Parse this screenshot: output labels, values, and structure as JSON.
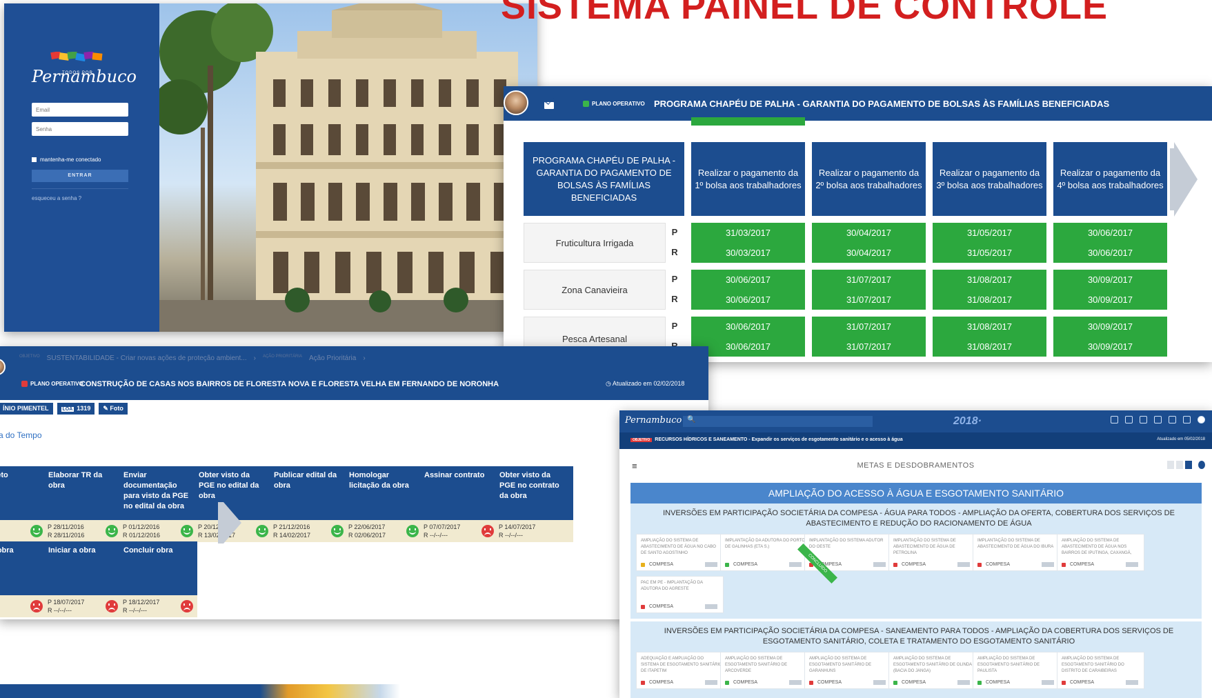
{
  "headline": "SISTEMA PAINEL DE CONTROLE",
  "login": {
    "logo_text": "Pernambuco",
    "logo_small": "TODOS POR",
    "email_placeholder": "Email",
    "password_placeholder": "Senha",
    "remember_label": "mantenha-me conectado",
    "submit_label": "ENTRAR",
    "forgot_label": "esqueceu a senha ?"
  },
  "chapeu": {
    "plano_label": "PLANO OPERATIVO",
    "title": "PROGRAMA CHAPÉU DE PALHA - GARANTIA DO PAGAMENTO DE BOLSAS ÀS FAMÍLIAS BENEFICIADAS",
    "head": "PROGRAMA CHAPÉU DE PALHA - GARANTIA DO PAGAMENTO DE BOLSAS ÀS FAMÍLIAS BENEFICIADAS",
    "columns": [
      "Realizar o pagamento da 1º bolsa aos trabalhadores",
      "Realizar o pagamento da 2º bolsa aos trabalhadores",
      "Realizar o pagamento da 3º bolsa aos trabalhadores",
      "Realizar o pagamento da 4º bolsa aos trabalhadores"
    ],
    "p_label": "P",
    "r_label": "R",
    "rows": [
      {
        "label": "Fruticultura Irrigada",
        "p": [
          "31/03/2017",
          "30/04/2017",
          "31/05/2017",
          "30/06/2017"
        ],
        "r": [
          "30/03/2017",
          "30/04/2017",
          "31/05/2017",
          "30/06/2017"
        ]
      },
      {
        "label": "Zona Canavieira",
        "p": [
          "30/06/2017",
          "31/07/2017",
          "31/08/2017",
          "30/09/2017"
        ],
        "r": [
          "30/06/2017",
          "31/07/2017",
          "31/08/2017",
          "30/09/2017"
        ]
      },
      {
        "label": "Pesca Artesanal",
        "p": [
          "30/06/2017",
          "31/07/2017",
          "31/08/2017",
          "30/09/2017"
        ],
        "r": [
          "30/06/2017",
          "31/07/2017",
          "31/08/2017",
          "30/09/2017"
        ]
      }
    ]
  },
  "construcao": {
    "crumb1": "SUSTENTABILIDADE - Criar novas ações de proteção ambient...",
    "crumb2": "Ação Prioritária",
    "plano_label": "PLANO OPERATIVO",
    "title": "CONSTRUÇÃO DE CASAS NOS BAIRROS DE FLORESTA NOVA E FLORESTA VELHA EM FERNANDO DE NORONHA",
    "updated": "Atualizado em 02/02/2018",
    "tag_person": "ÍNIO PIMENTEL",
    "tag_loa_label": "LOA",
    "tag_loa_value": "1319",
    "tag_foto": "Foto",
    "timeline_title": "a do Tempo",
    "steps_row1": [
      {
        "title": "ar projeto",
        "p": "1/2016",
        "r": "1/2016",
        "status": "happy"
      },
      {
        "title": "Elaborar TR da obra",
        "p": "P  28/11/2016",
        "r": "R  28/11/2016",
        "status": "happy"
      },
      {
        "title": "Enviar documentação para visto da PGE no edital da obra",
        "p": "P  01/12/2016",
        "r": "R  01/12/2016",
        "status": "happy"
      },
      {
        "title": "Obter visto da PGE no edital da obra",
        "p": "P  20/12/2016",
        "r": "R  13/02/2017",
        "status": "happy"
      },
      {
        "title": "Publicar edital da obra",
        "p": "P  21/12/2016",
        "r": "R  14/02/2017",
        "status": "happy"
      },
      {
        "title": "Homologar licitação da obra",
        "p": "P  22/06/2017",
        "r": "R  02/06/2017",
        "status": "happy"
      },
      {
        "title": "Assinar contrato",
        "p": "P  07/07/2017",
        "r": "R  --/--/---",
        "status": "sad"
      },
      {
        "title": "Obter visto da PGE no contrato da obra",
        "p": "P  14/07/2017",
        "r": "R  --/--/---",
        "status": "none"
      }
    ],
    "steps_row2": [
      {
        "title": "OS da obra",
        "p": "7/2017",
        "r": "/---",
        "status": "sad"
      },
      {
        "title": "Iniciar a obra",
        "p": "P  18/07/2017",
        "r": "R  --/--/---",
        "status": "sad"
      },
      {
        "title": "Concluir obra",
        "p": "P  18/12/2017",
        "r": "R  --/--/---",
        "status": "sad"
      }
    ]
  },
  "metas": {
    "logo_text": "Pernambuco",
    "search_glyph": "🔍",
    "year": "2018·",
    "sub_tag": "OBJETIVO",
    "sub_text": "RECURSOS HÍDRICOS E SANEAMENTO - Expandir os serviços de esgotamento sanitário e o acesso à água",
    "sub_updated": "Atualizado em 05/02/2018",
    "header_label": "METAS E DESDOBRAMENTOS",
    "band_title": "AMPLIAÇÃO DO ACESSO À ÁGUA E ESGOTAMENTO SANITÁRIO",
    "section1": "INVERSÕES EM PARTICIPAÇÃO SOCIETÁRIA DA COMPESA - ÁGUA PARA TODOS - AMPLIAÇÃO DA OFERTA, COBERTURA DOS SERVIÇOS DE ABASTECIMENTO E REDUÇÃO DO RACIONAMENTO DE ÁGUA",
    "section2": "INVERSÕES EM PARTICIPAÇÃO SOCIETÁRIA DA COMPESA - SANEAMENTO PARA TODOS - AMPLIAÇÃO DA COBERTURA DOS SERVIÇOS DE ESGOTAMENTO SANITÁRIO, COLETA E TRATAMENTO DO ESGOTAMENTO SANITÁRIO",
    "ribbon": "CONCLUÍDO",
    "org": "COMPESA",
    "cards1": [
      {
        "text": "AMPLIAÇÃO DO SISTEMA DE ABASTECIMENTO DE ÁGUA NO CABO DE SANTO AGOSTINHO",
        "color": "#e8b11c"
      },
      {
        "text": "IMPLANTAÇÃO DA ADUTORA DO PORTO DE GALINHAS (ETA S.)",
        "color": "#3bb54a"
      },
      {
        "text": "IMPLANTAÇÃO DO SISTEMA ADUTOR DO OESTE",
        "color": "#e03b3b"
      },
      {
        "text": "IMPLANTAÇÃO DO SISTEMA DE ABASTECIMENTO DE ÁGUA DE PETROLINA",
        "color": "#e03b3b"
      },
      {
        "text": "IMPLANTAÇÃO DO SISTEMA DE ABASTECIMENTO DE ÁGUA DO IBURA",
        "color": "#e03b3b"
      },
      {
        "text": "AMPLIAÇÃO DO SISTEMA DE ABASTECIMENTO DE ÁGUA NOS BAIRROS DE IPUTINGA, CAXANGÁ,",
        "color": "#e03b3b"
      },
      {
        "text": "PAC EM PE - IMPLANTAÇÃO DA ADUTORA DO AGRESTE",
        "color": "#e03b3b"
      }
    ],
    "cards2": [
      {
        "text": "ADEQUAÇÃO E AMPLIAÇÃO DO SISTEMA DE ESGOTAMENTO SANITÁRIO DE ITAPETIM",
        "color": "#e03b3b"
      },
      {
        "text": "AMPLIAÇÃO DO SISTEMA DE ESGOTAMENTO SANITÁRIO DE ARCOVERDE",
        "color": "#3bb54a"
      },
      {
        "text": "AMPLIAÇÃO DO SISTEMA DE ESGOTAMENTO SANITÁRIO DE GARANHUNS",
        "color": "#e03b3b"
      },
      {
        "text": "AMPLIAÇÃO DO SISTEMA DE ESGOTAMENTO SANITÁRIO DE OLINDA (BACIA DO JANGA)",
        "color": "#3bb54a"
      },
      {
        "text": "AMPLIAÇÃO DO SISTEMA DE ESGOTAMENTO SANITÁRIO DE PAULISTA",
        "color": "#3bb54a"
      },
      {
        "text": "AMPLIAÇÃO DO SISTEMA DE ESGOTAMENTO SANITÁRIO DO DISTRITO DE CARAIBEIRAS",
        "color": "#e03b3b"
      }
    ]
  }
}
